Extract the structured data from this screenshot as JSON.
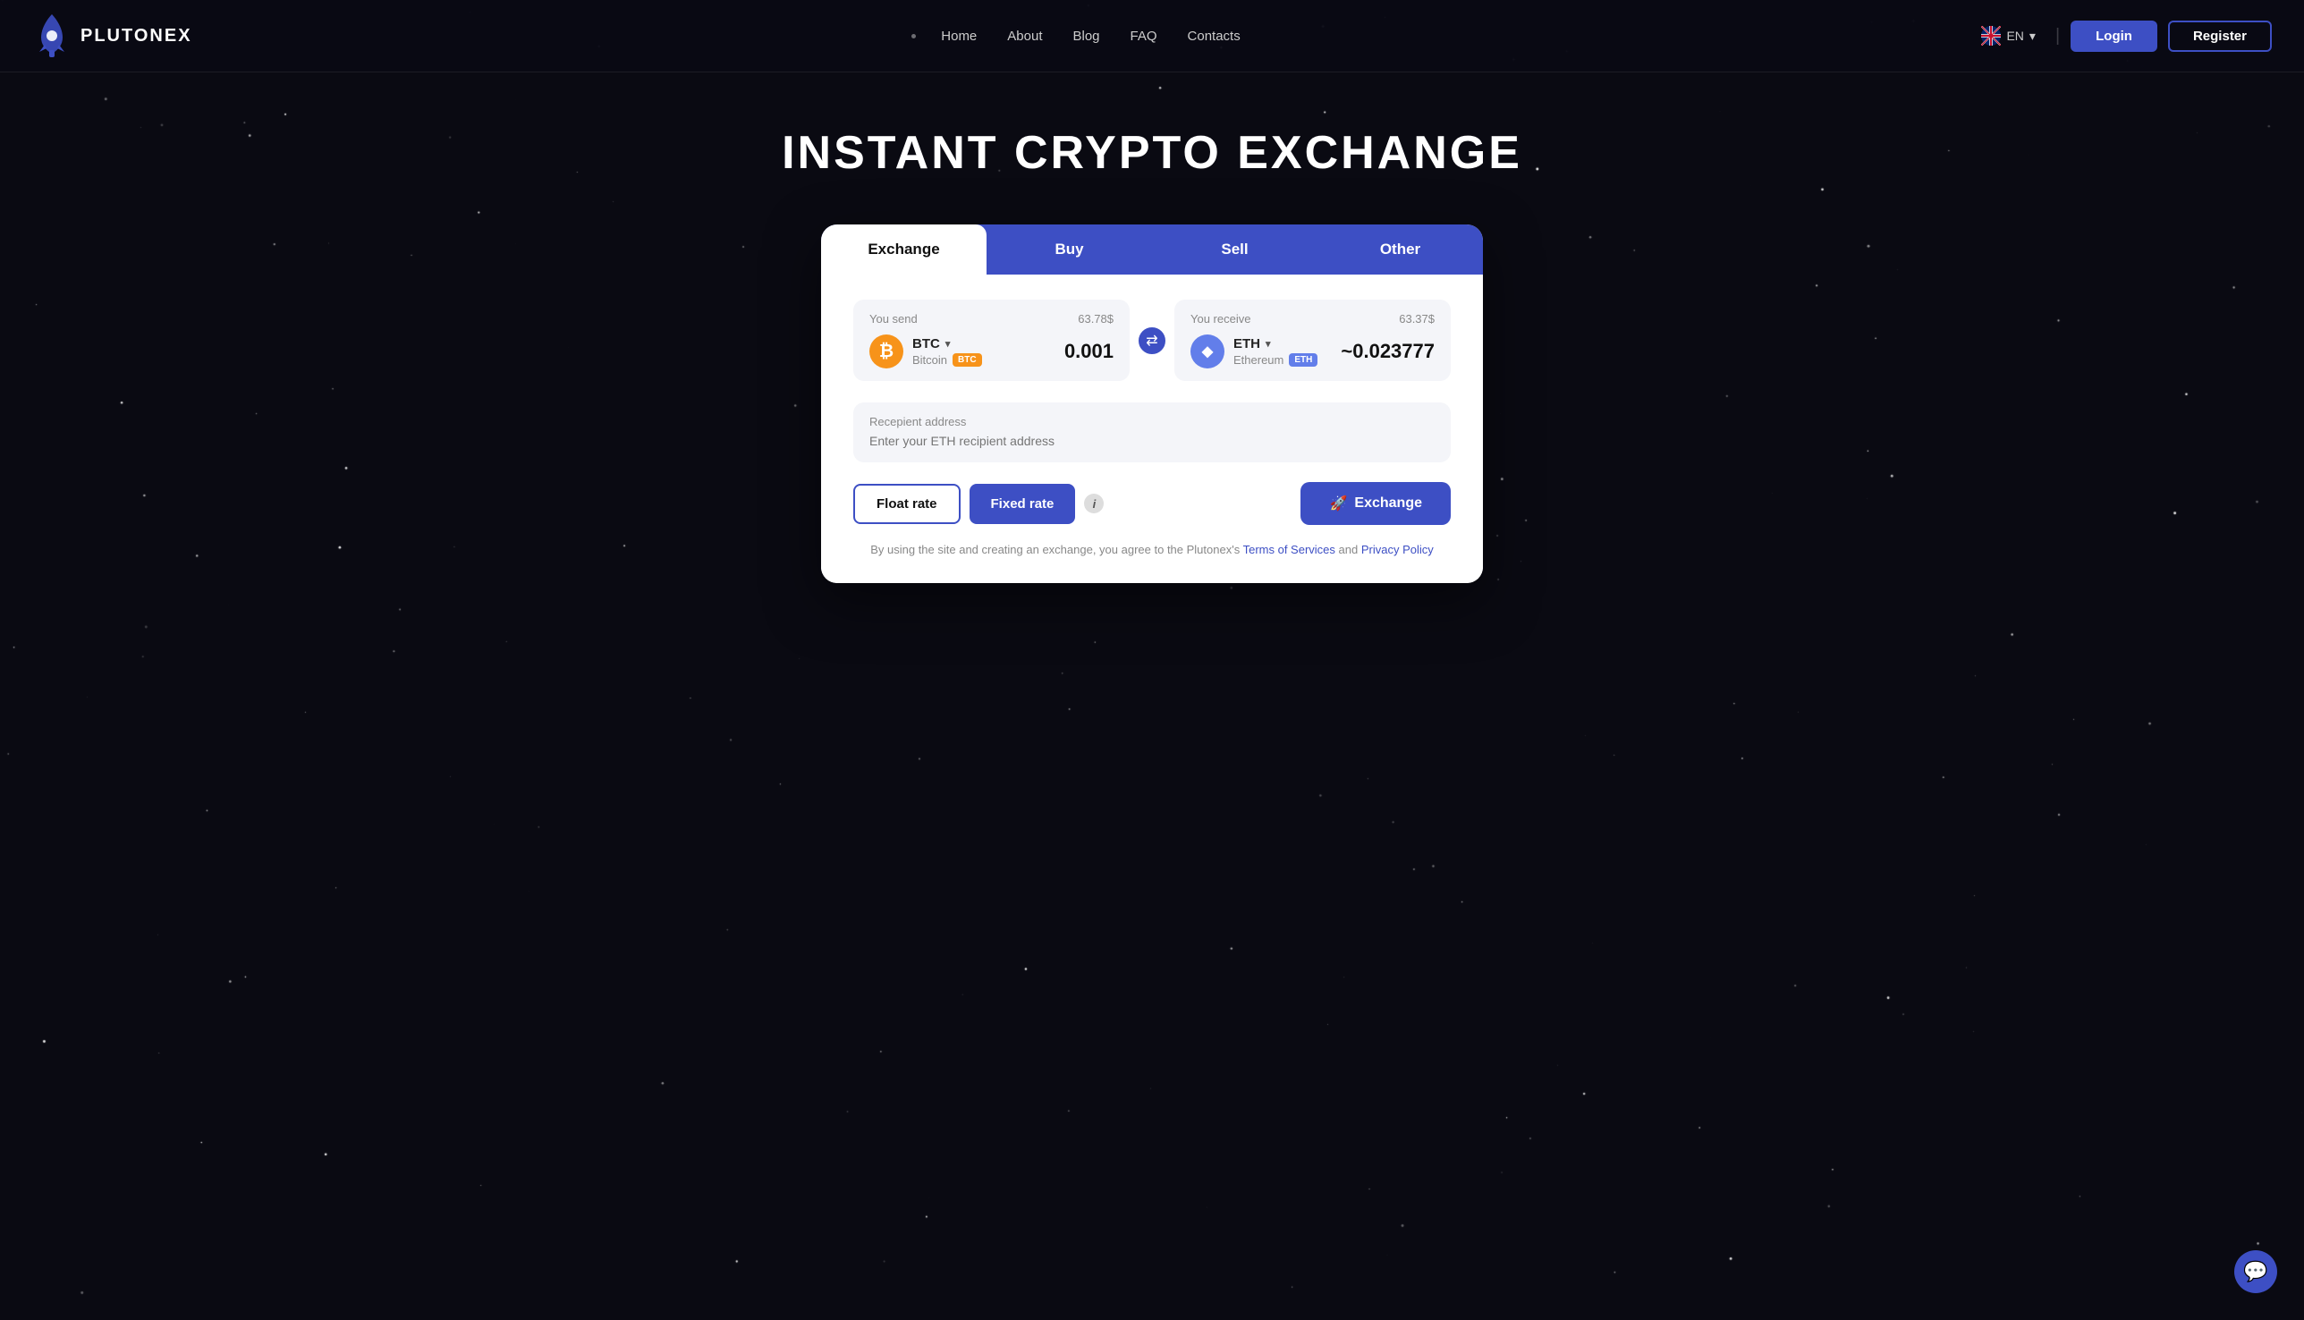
{
  "brand": {
    "name": "PLUTONEX",
    "logo_icon": "🚀"
  },
  "nav": {
    "links": [
      "Home",
      "About",
      "Blog",
      "FAQ",
      "Contacts"
    ],
    "language": "EN",
    "login_label": "Login",
    "register_label": "Register"
  },
  "hero": {
    "title": "INSTANT CRYPTO EXCHANGE"
  },
  "exchange_card": {
    "tabs": [
      {
        "label": "Exchange",
        "active": true
      },
      {
        "label": "Buy",
        "active": false
      },
      {
        "label": "Sell",
        "active": false
      },
      {
        "label": "Other",
        "active": false
      }
    ],
    "send": {
      "label": "You send",
      "usd_value": "63.78$",
      "currency_code": "BTC",
      "currency_chevron": "▾",
      "currency_full": "Bitcoin",
      "currency_badge": "BTC",
      "amount": "0.001"
    },
    "receive": {
      "label": "You receive",
      "usd_value": "63.37$",
      "currency_code": "ETH",
      "currency_chevron": "▾",
      "currency_full": "Ethereum",
      "currency_badge": "ETH",
      "amount": "~0.023777"
    },
    "swap_icon": "⇄",
    "address": {
      "label": "Recepient address",
      "placeholder": "Enter your ETH recipient address"
    },
    "rate_buttons": {
      "float_label": "Float rate",
      "fixed_label": "Fixed rate",
      "info_label": "i"
    },
    "exchange_button": {
      "icon": "🚀",
      "label": "Exchange"
    },
    "terms_text": "By using the site and creating an exchange, you agree to the Plutonex's",
    "terms_of_service": "Terms of Services",
    "terms_and": "and",
    "privacy_policy": "Privacy Policy"
  },
  "chat": {
    "icon": "💬"
  }
}
